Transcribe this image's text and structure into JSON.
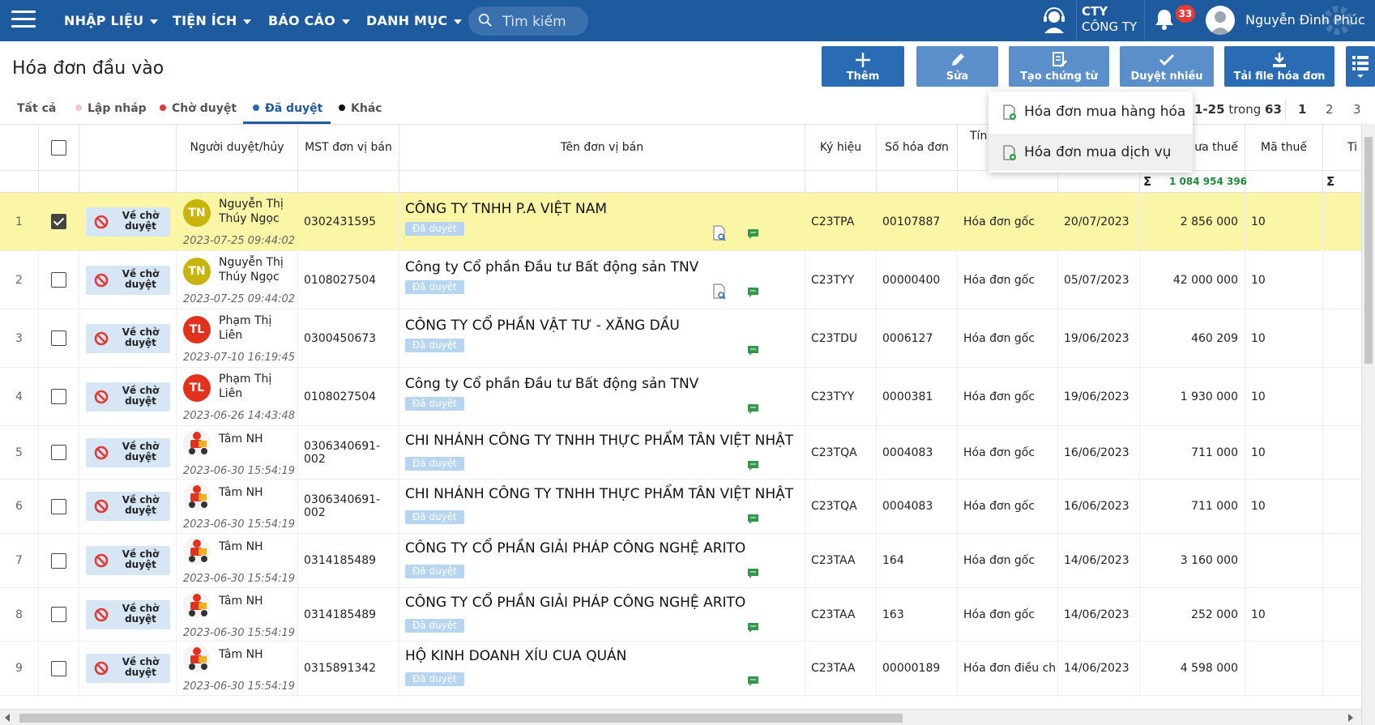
{
  "nav": {
    "items": [
      "NHẬP LIỆU",
      "TIỆN ÍCH",
      "BÁO CÁO",
      "DANH MỤC"
    ],
    "search_placeholder": "Tìm kiếm",
    "company_short": "CTY",
    "company_name": "CÔNG TY",
    "notification_count": "33",
    "user_name": "Nguyễn Đình Phúc"
  },
  "page": {
    "title": "Hóa đơn đầu vào"
  },
  "toolbar": {
    "add": "Thêm",
    "edit": "Sửa",
    "create_voucher": "Tạo chứng từ",
    "approve_many": "Duyệt nhiều",
    "download": "Tải file hóa đơn"
  },
  "dropdown": {
    "items": [
      "Hóa đơn mua hàng hóa",
      "Hóa đơn mua dịch vụ"
    ]
  },
  "tabs": [
    {
      "label": "Tất cả",
      "dot": ""
    },
    {
      "label": "Lập nháp",
      "dot": "#f2c4d0"
    },
    {
      "label": "Chờ duyệt",
      "dot": "#e53935"
    },
    {
      "label": "Đã duyệt",
      "dot": "#2a6cb4"
    },
    {
      "label": "Khác",
      "dot": "#111111"
    }
  ],
  "pager": {
    "range": "1-25",
    "of_word": "trong",
    "total": "63",
    "pages": [
      "1",
      "2",
      "3"
    ]
  },
  "columns": {
    "approver": "Người duyệt/hủy",
    "tax_code": "MST đơn vị bán",
    "vendor": "Tên đơn vị bán",
    "symbol": "Ký hiệu",
    "invoice_no": "Số hóa đơn",
    "nature_partial": "Tín",
    "pretax_partial": "ưa thuế",
    "tax_code_col": "Mã thuế",
    "last_partial": "Ti"
  },
  "summary": {
    "pretax_total": "1 084 954 396"
  },
  "return_label_1": "Về chờ",
  "return_label_2": "duyệt",
  "status_badge": "Đã duyệt",
  "rows": [
    {
      "n": "1",
      "checked": true,
      "av": "TN",
      "avc": "tn",
      "name1": "Nguyễn Thị",
      "name2": "Thúy Ngọc",
      "time": "2023-07-25 09:44:02",
      "mst": "0302431595",
      "vendor": "CÔNG TY TNHH P.A VIỆT NAM",
      "doc": true,
      "sym": "C23TPA",
      "no": "00107887",
      "nature": "Hóa đơn gốc",
      "date": "20/07/2023",
      "amount": "2 856 000",
      "tax": "10"
    },
    {
      "n": "2",
      "checked": false,
      "av": "TN",
      "avc": "tn",
      "name1": "Nguyễn Thị",
      "name2": "Thúy Ngọc",
      "time": "2023-07-25 09:44:02",
      "mst": "0108027504",
      "vendor": "Công ty Cổ phần Đầu tư Bất động sản TNV",
      "doc": true,
      "sym": "C23TYY",
      "no": "00000400",
      "nature": "Hóa đơn gốc",
      "date": "05/07/2023",
      "amount": "42 000 000",
      "tax": "10"
    },
    {
      "n": "3",
      "checked": false,
      "av": "TL",
      "avc": "tl",
      "name1": "Phạm Thị",
      "name2": "Liên",
      "time": "2023-07-10 16:19:45",
      "mst": "0300450673",
      "vendor": "CÔNG TY CỔ PHẦN VẬT TƯ - XĂNG DẦU",
      "doc": false,
      "sym": "C23TDU",
      "no": "0006127",
      "nature": "Hóa đơn gốc",
      "date": "19/06/2023",
      "amount": "460 209",
      "tax": "10"
    },
    {
      "n": "4",
      "checked": false,
      "av": "TL",
      "avc": "tl",
      "name1": "Phạm Thị",
      "name2": "Liên",
      "time": "2023-06-26 14:43:48",
      "mst": "0108027504",
      "vendor": "Công ty Cổ phần Đầu tư Bất động sản TNV",
      "doc": false,
      "sym": "C23TYY",
      "no": "0000381",
      "nature": "Hóa đơn gốc",
      "date": "19/06/2023",
      "amount": "1 930 000",
      "tax": "10"
    },
    {
      "n": "5",
      "checked": false,
      "av": "",
      "avc": "img",
      "name1": "Tâm NH",
      "name2": "",
      "time": "2023-06-30 15:54:19",
      "mst": "0306340691-002",
      "vendor": "CHI NHÁNH CÔNG TY TNHH THỰC PHẨM TÂN VIỆT NHẬT",
      "doc": false,
      "sym": "C23TQA",
      "no": "0004083",
      "nature": "Hóa đơn gốc",
      "date": "16/06/2023",
      "amount": "711 000",
      "tax": "10"
    },
    {
      "n": "6",
      "checked": false,
      "av": "",
      "avc": "img",
      "name1": "Tâm NH",
      "name2": "",
      "time": "2023-06-30 15:54:19",
      "mst": "0306340691-002",
      "vendor": "CHI NHÁNH CÔNG TY TNHH THỰC PHẨM TÂN VIỆT NHẬT",
      "doc": false,
      "sym": "C23TQA",
      "no": "0004083",
      "nature": "Hóa đơn gốc",
      "date": "16/06/2023",
      "amount": "711 000",
      "tax": "10"
    },
    {
      "n": "7",
      "checked": false,
      "av": "",
      "avc": "img",
      "name1": "Tâm NH",
      "name2": "",
      "time": "2023-06-30 15:54:19",
      "mst": "0314185489",
      "vendor": "CÔNG TY CỔ PHẦN GIẢI PHÁP CÔNG NGHỆ ARITO",
      "doc": false,
      "sym": "C23TAA",
      "no": "164",
      "nature": "Hóa đơn gốc",
      "date": "14/06/2023",
      "amount": "3 160 000",
      "tax": ""
    },
    {
      "n": "8",
      "checked": false,
      "av": "",
      "avc": "img",
      "name1": "Tâm NH",
      "name2": "",
      "time": "2023-06-30 15:54:19",
      "mst": "0314185489",
      "vendor": "CÔNG TY CỔ PHẦN GIẢI PHÁP CÔNG NGHỆ ARITO",
      "doc": false,
      "sym": "C23TAA",
      "no": "163",
      "nature": "Hóa đơn gốc",
      "date": "14/06/2023",
      "amount": "252 000",
      "tax": "10"
    },
    {
      "n": "9",
      "checked": false,
      "av": "",
      "avc": "img",
      "name1": "Tâm NH",
      "name2": "",
      "time": "2023-06-30 15:54:19",
      "mst": "0315891342",
      "vendor": "HỘ KINH DOANH XÍU CUA QUÁN",
      "doc": false,
      "sym": "C23TAA",
      "no": "00000189",
      "nature": "Hóa đơn điều ch",
      "date": "14/06/2023",
      "amount": "4 598 000",
      "tax": ""
    }
  ]
}
